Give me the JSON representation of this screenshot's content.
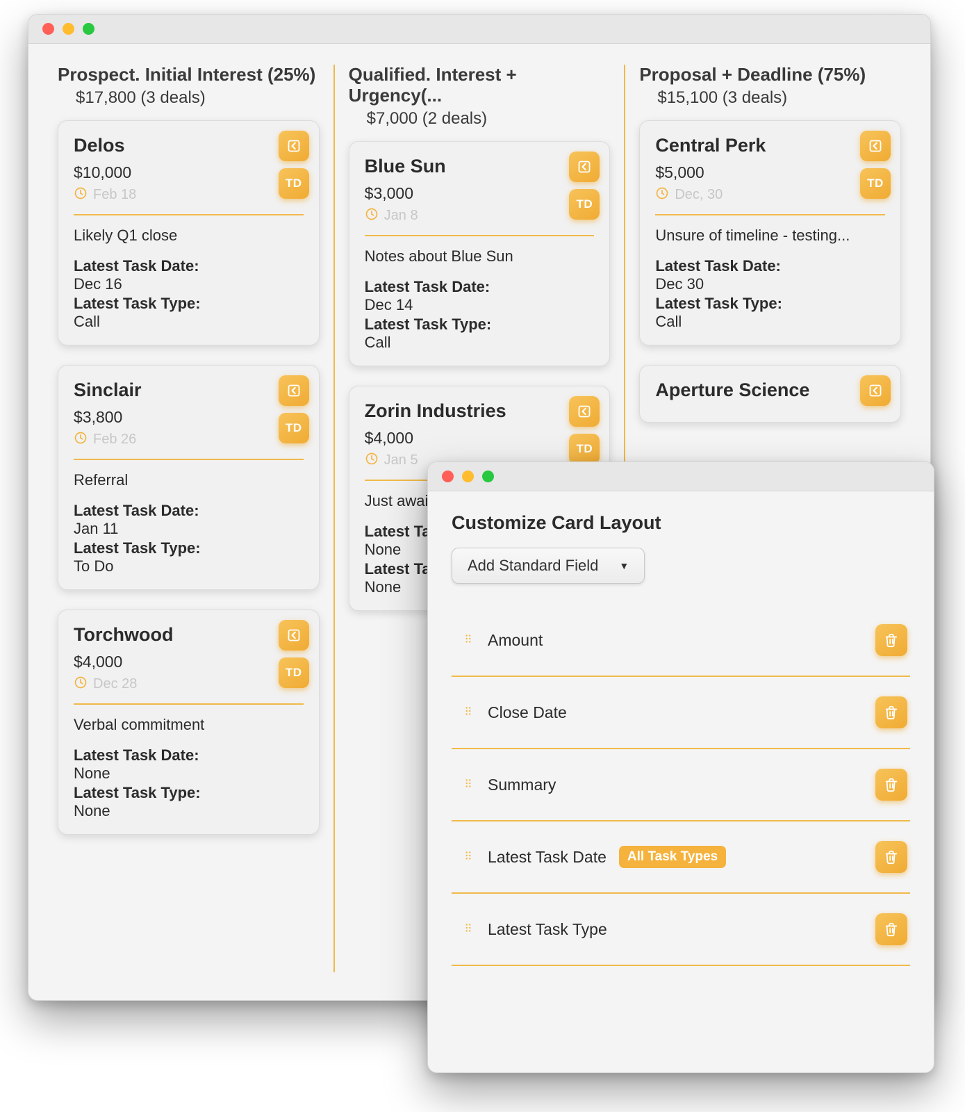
{
  "board": {
    "columns": [
      {
        "title": "Prospect. Initial Interest (25%)",
        "subtitle": "$17,800 (3 deals)",
        "cards": [
          {
            "name": "Delos",
            "amount": "$10,000",
            "close_date": "Feb 18",
            "summary": "Likely Q1 close",
            "latest_task_date_label": "Latest Task Date:",
            "latest_task_date": "Dec 16",
            "latest_task_type_label": "Latest Task Type:",
            "latest_task_type": "Call",
            "badge": "TD"
          },
          {
            "name": "Sinclair",
            "amount": "$3,800",
            "close_date": "Feb 26",
            "summary": "Referral",
            "latest_task_date_label": "Latest Task Date:",
            "latest_task_date": "Jan 11",
            "latest_task_type_label": "Latest Task Type:",
            "latest_task_type": "To Do",
            "badge": "TD"
          },
          {
            "name": "Torchwood",
            "amount": "$4,000",
            "close_date": "Dec 28",
            "summary": "Verbal commitment",
            "latest_task_date_label": "Latest Task Date:",
            "latest_task_date": "None",
            "latest_task_type_label": "Latest Task Type:",
            "latest_task_type": "None",
            "badge": "TD"
          }
        ]
      },
      {
        "title": "Qualified. Interest + Urgency(...",
        "subtitle": "$7,000 (2 deals)",
        "cards": [
          {
            "name": "Blue Sun",
            "amount": "$3,000",
            "close_date": "Jan 8",
            "summary": "Notes about Blue Sun",
            "latest_task_date_label": "Latest Task Date:",
            "latest_task_date": "Dec 14",
            "latest_task_type_label": "Latest Task Type:",
            "latest_task_type": "Call",
            "badge": "TD"
          },
          {
            "name": "Zorin Industries",
            "amount": "$4,000",
            "close_date": "Jan 5",
            "summary": "Just awai",
            "latest_task_date_label": "Latest Tas",
            "latest_task_date": "None",
            "latest_task_type_label": "Latest Tas",
            "latest_task_type": "None",
            "badge": "TD"
          }
        ]
      },
      {
        "title": "Proposal + Deadline (75%)",
        "subtitle": "$15,100 (3 deals)",
        "cards": [
          {
            "name": "Central Perk",
            "amount": "$5,000",
            "close_date": "Dec, 30",
            "summary": "Unsure of timeline - testing...",
            "latest_task_date_label": "Latest Task Date:",
            "latest_task_date": "Dec 30",
            "latest_task_type_label": "Latest Task Type:",
            "latest_task_type": "Call",
            "badge": "TD"
          },
          {
            "name": "Aperture Science",
            "amount": "",
            "close_date": "",
            "summary": "",
            "latest_task_date_label": "",
            "latest_task_date": "",
            "latest_task_type_label": "",
            "latest_task_type": "",
            "badge": ""
          }
        ]
      }
    ]
  },
  "customize": {
    "title": "Customize Card Layout",
    "add_field_label": "Add Standard Field",
    "fields": [
      {
        "label": "Amount",
        "tag": ""
      },
      {
        "label": "Close Date",
        "tag": ""
      },
      {
        "label": "Summary",
        "tag": ""
      },
      {
        "label": "Latest Task Date",
        "tag": "All Task Types"
      },
      {
        "label": "Latest Task Type",
        "tag": ""
      }
    ]
  },
  "colors": {
    "accent": "#f0ab33",
    "accent_light": "#f7c35a",
    "divider": "#f0b94a"
  }
}
